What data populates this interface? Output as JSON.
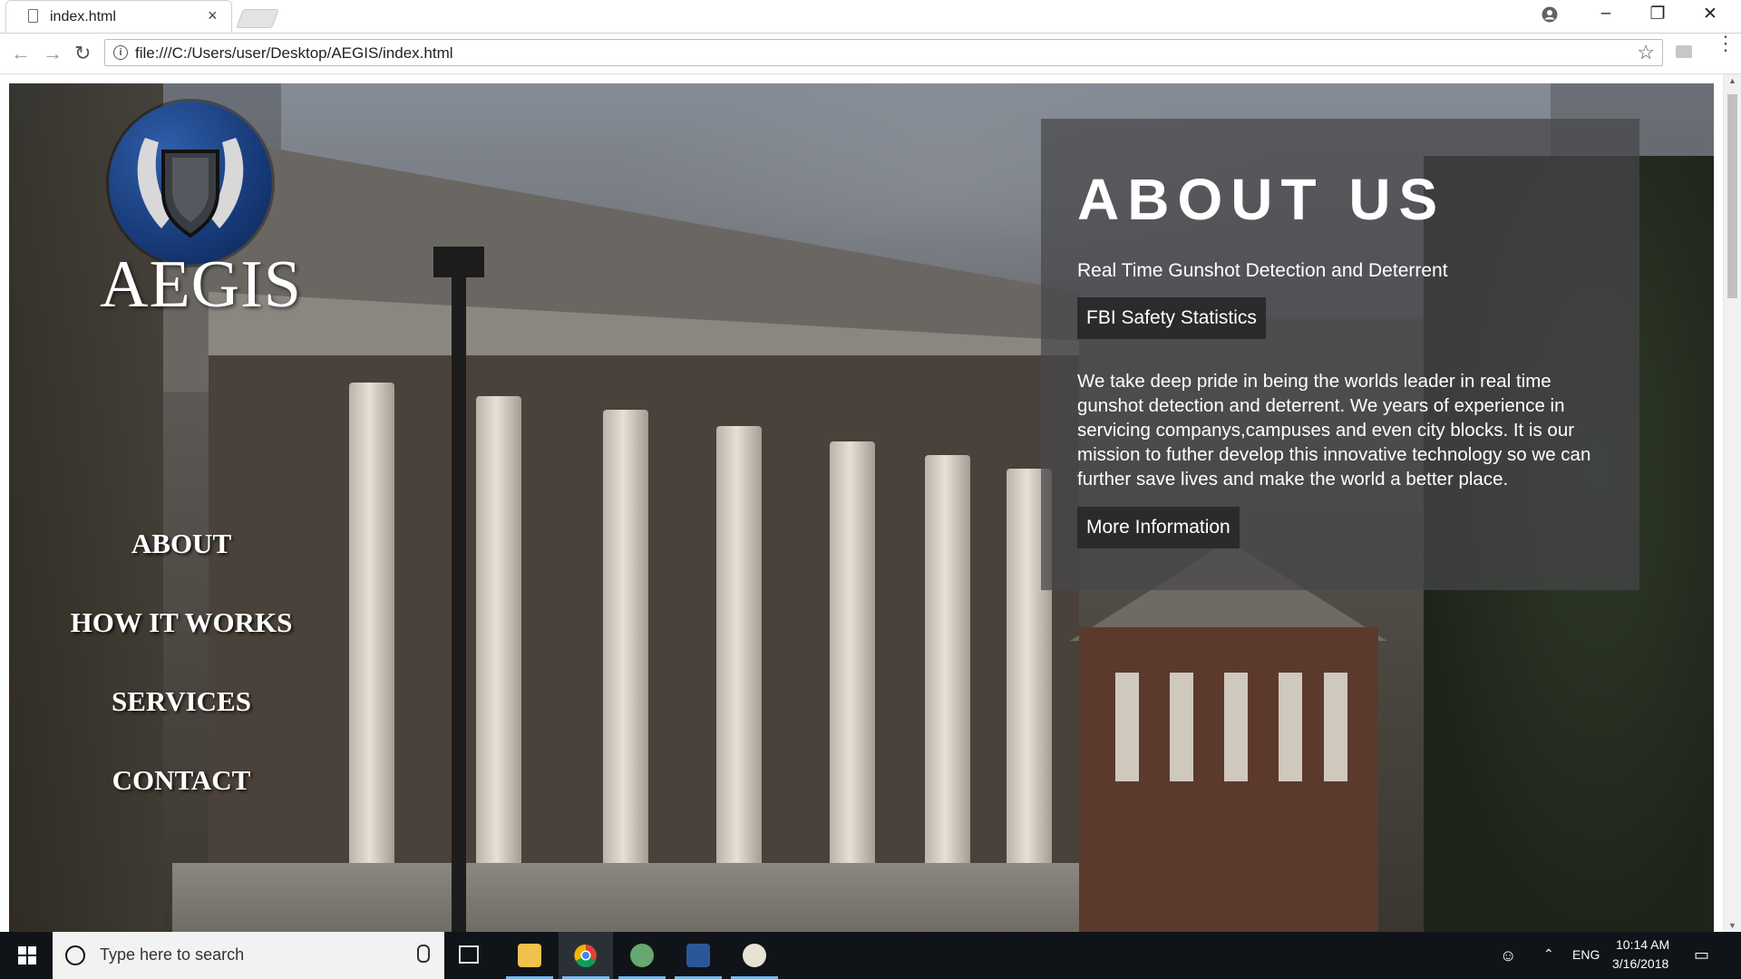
{
  "browser": {
    "tab_title": "index.html",
    "tab_close": "×",
    "url": "file:///C:/Users/user/Desktop/AEGIS/index.html",
    "window_minimize": "–",
    "window_restore": "❐",
    "window_close": "✕",
    "back": "←",
    "forward": "→",
    "reload": "↻",
    "star": "☆",
    "menu": "⋮"
  },
  "site": {
    "brand": "AEGIS",
    "nav": [
      "ABOUT",
      "HOW IT WORKS",
      "SERVICES",
      "CONTACT"
    ],
    "about": {
      "title": "ABOUT US",
      "subtitle": "Real Time Gunshot Detection and Deterrent",
      "stats_button": "FBI Safety Statistics",
      "body": "We take deep pride in being the worlds leader in real time gunshot detection and deterrent. We years of experience in servicing companys,campuses and even city blocks. It is our mission to futher develop this innovative technology so we can further save lives and make the world a better place.",
      "more_button": "More Information"
    }
  },
  "taskbar": {
    "search_placeholder": "Type here to search",
    "language": "ENG",
    "time": "10:14 AM",
    "date": "3/16/2018",
    "apps": [
      {
        "name": "file-explorer",
        "color": "#f0c14b",
        "active": false
      },
      {
        "name": "chrome",
        "color": "#dd4b39",
        "active": true
      },
      {
        "name": "atom",
        "color": "#66a870",
        "active": false
      },
      {
        "name": "word",
        "color": "#2b579a",
        "active": false
      },
      {
        "name": "paint",
        "color": "#e8e2d3",
        "active": false
      }
    ]
  },
  "colors": {
    "panel_bg": "rgba(70,70,74,0.72)",
    "button_bg": "#2b2b2d",
    "taskbar_bg": "#101418",
    "accent": "#76b9ed"
  }
}
